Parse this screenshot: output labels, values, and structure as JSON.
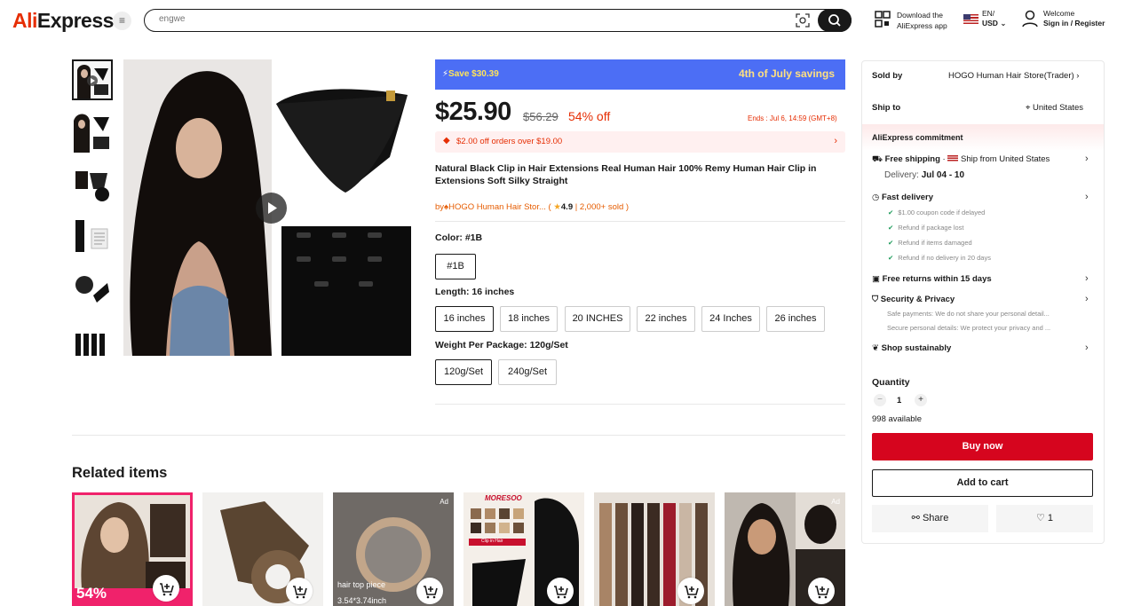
{
  "header": {
    "logo_prefix": "Ali",
    "logo_suffix": "Express",
    "search_placeholder": "engwe",
    "download_line1": "Download the",
    "download_line2": "AliExpress app",
    "lang_line1": "EN/",
    "lang_line2": "USD",
    "user_line1": "Welcome",
    "user_line2": "Sign in / Register"
  },
  "product": {
    "banner_save": "Save $30.39",
    "banner_event": "4th of July savings",
    "price": "$25.90",
    "old_price": "$56.29",
    "discount": "54% off",
    "ends": "Ends :  Jul 6, 14:59 (GMT+8)",
    "coupon": "$2.00 off orders over $19.00",
    "title": "Natural Black Clip in Hair Extensions Real Human Hair 100% Remy Human Hair Clip in Extensions Soft Silky Straight",
    "store_prefix": "by",
    "store_name": "HOGO Human Hair Stor...",
    "rating": "4.9",
    "sold": "| 2,000+ sold )",
    "color_label": "Color: #1B",
    "colors": [
      "#1B"
    ],
    "length_label": "Length: 16 inches",
    "lengths": [
      "16 inches",
      "18 inches",
      "20 INCHES",
      "22 inches",
      "24 Inches",
      "26 inches"
    ],
    "weight_label": "Weight Per Package: 120g/Set",
    "weights": [
      "120g/Set",
      "240g/Set"
    ]
  },
  "panel": {
    "sold_by_label": "Sold by",
    "sold_by_value": "HOGO Human Hair Store(Trader)",
    "ship_to_label": "Ship to",
    "ship_to_value": "United States",
    "commitment": "AliExpress commitment",
    "free_shipping": "Free shipping",
    "ship_from": "Ship from United States",
    "delivery_label": "Delivery:",
    "delivery_value": "Jul 04 - 10",
    "fast_delivery": "Fast delivery",
    "fast_items": [
      "$1.00 coupon code if delayed",
      "Refund if package lost",
      "Refund if items damaged",
      "Refund if no delivery in 20 days"
    ],
    "free_returns": "Free returns within 15 days",
    "security": "Security & Privacy",
    "security_items": [
      "Safe payments: We do not share your personal detail...",
      "Secure personal details: We protect your privacy and ..."
    ],
    "sustainably": "Shop sustainably",
    "quantity_label": "Quantity",
    "quantity": "1",
    "available": "998 available",
    "buy_now": "Buy now",
    "add_to_cart": "Add to cart",
    "share": "Share",
    "wishlist_count": "1"
  },
  "related": {
    "title": "Related items",
    "cards": [
      {
        "badge": "54%",
        "ad": ""
      },
      {
        "badge": "",
        "ad": ""
      },
      {
        "badge": "",
        "ad": "Ad",
        "caption1": "hair top piece",
        "caption2": "3.54*3.74inch"
      },
      {
        "badge": "",
        "ad": "",
        "brand": "MORESOO",
        "tag": "Clip in Hair"
      },
      {
        "badge": "",
        "ad": ""
      },
      {
        "badge": "",
        "ad": "Ad"
      }
    ]
  },
  "colors": {
    "accent": "#e62e04",
    "buy": "#d6051e",
    "banner": "#4c6ef5"
  }
}
